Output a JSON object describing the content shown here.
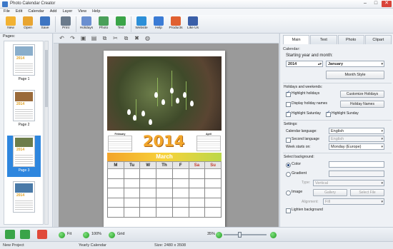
{
  "window": {
    "title": "Photo Calendar Creator"
  },
  "menu": [
    "File",
    "Edit",
    "Calendar",
    "Add",
    "Layer",
    "View",
    "Help"
  ],
  "toolbar": {
    "buttons": [
      {
        "label": "New",
        "icon": "new-file-icon",
        "color": "#f2b233"
      },
      {
        "label": "Open",
        "icon": "open-folder-icon",
        "color": "#e8a531"
      },
      {
        "label": "Save",
        "icon": "save-disk-icon",
        "color": "#3d75c2"
      },
      {
        "label": "Print",
        "icon": "printer-icon",
        "color": "#6b7b8c"
      },
      {
        "label": "Holidays",
        "icon": "holidays-icon",
        "color": "#6a8fd0"
      },
      {
        "label": "Photo",
        "icon": "photo-icon",
        "color": "#4aa05a"
      },
      {
        "label": "Text",
        "icon": "text-icon",
        "color": "#3aa448"
      },
      {
        "label": "Website",
        "icon": "website-icon",
        "color": "#2c8fd8"
      },
      {
        "label": "Help",
        "icon": "help-icon",
        "color": "#3a7bd5"
      },
      {
        "label": "Products",
        "icon": "products-icon",
        "color": "#e06030"
      },
      {
        "label": "Like Us",
        "icon": "like-us-icon",
        "color": "#3a5fa8"
      }
    ]
  },
  "pages_panel": {
    "header": "Pages:",
    "pages": [
      {
        "label": "Page 1",
        "year": "2014",
        "selected": false,
        "photo_color": "#8aaecb"
      },
      {
        "label": "Page 2",
        "year": "2014",
        "selected": false,
        "photo_color": "#9a6a3a"
      },
      {
        "label": "Page 3",
        "year": "2014",
        "selected": true,
        "photo_color": "#6d7d4a"
      },
      {
        "label": "",
        "year": "2014",
        "selected": false,
        "photo_color": "#4a7aa8"
      }
    ]
  },
  "editor": {
    "edit_buttons": [
      "↶",
      "↷",
      "▣",
      "▤",
      "⧉",
      "✂",
      "⧉",
      "✖",
      "◍"
    ]
  },
  "calendar_page": {
    "year": "2014",
    "mini_left": {
      "title": "February"
    },
    "mini_right": {
      "title": "April"
    },
    "month": "March",
    "weekdays": [
      "M",
      "Tu",
      "W",
      "Th",
      "F",
      "Sa",
      "Su"
    ],
    "weekend_indexes": [
      5,
      6
    ]
  },
  "right_panel": {
    "tabs": [
      "Main",
      "Text",
      "Photo",
      "Clipart"
    ],
    "calendar_header": "Calendar:",
    "start_label": "Starting year and month:",
    "year": "2014",
    "month": "January",
    "month_style_button": "Month Style",
    "holidays_header": "Holidays and weekends:",
    "highlight_holidays": "Highlight holidays",
    "customize_holidays": "Customize Holidays",
    "display_holiday_names": "Display holiday names",
    "holiday_names_button": "Holiday Names",
    "highlight_saturday": "Highlight Saturday",
    "highlight_sunday": "Highlight Sunday",
    "settings_header": "Settings:",
    "calendar_language_label": "Calendar language:",
    "calendar_language": "English",
    "second_language_label": "Second language",
    "second_language": "English",
    "week_starts_label": "Week starts on:",
    "week_starts": "Monday (Europe)",
    "background_header": "Select background:",
    "color_label": "Color",
    "gradient_label": "Gradient",
    "type_label": "Type:",
    "type_value": "Vertical",
    "image_label": "Image",
    "gallery_button": "Gallery",
    "select_file_button": "Select File",
    "alignment_label": "Alignment:",
    "alignment_value": "Fill",
    "lighten_background": "Lighten background"
  },
  "bottom": {
    "fit_label": "Fit",
    "zoom_100": "100%",
    "grid_label": "Grid",
    "zoom_value": "35%"
  },
  "status": {
    "project": "New Project",
    "type": "Yearly Calendar",
    "size": "Size: 2480 x 3508"
  }
}
